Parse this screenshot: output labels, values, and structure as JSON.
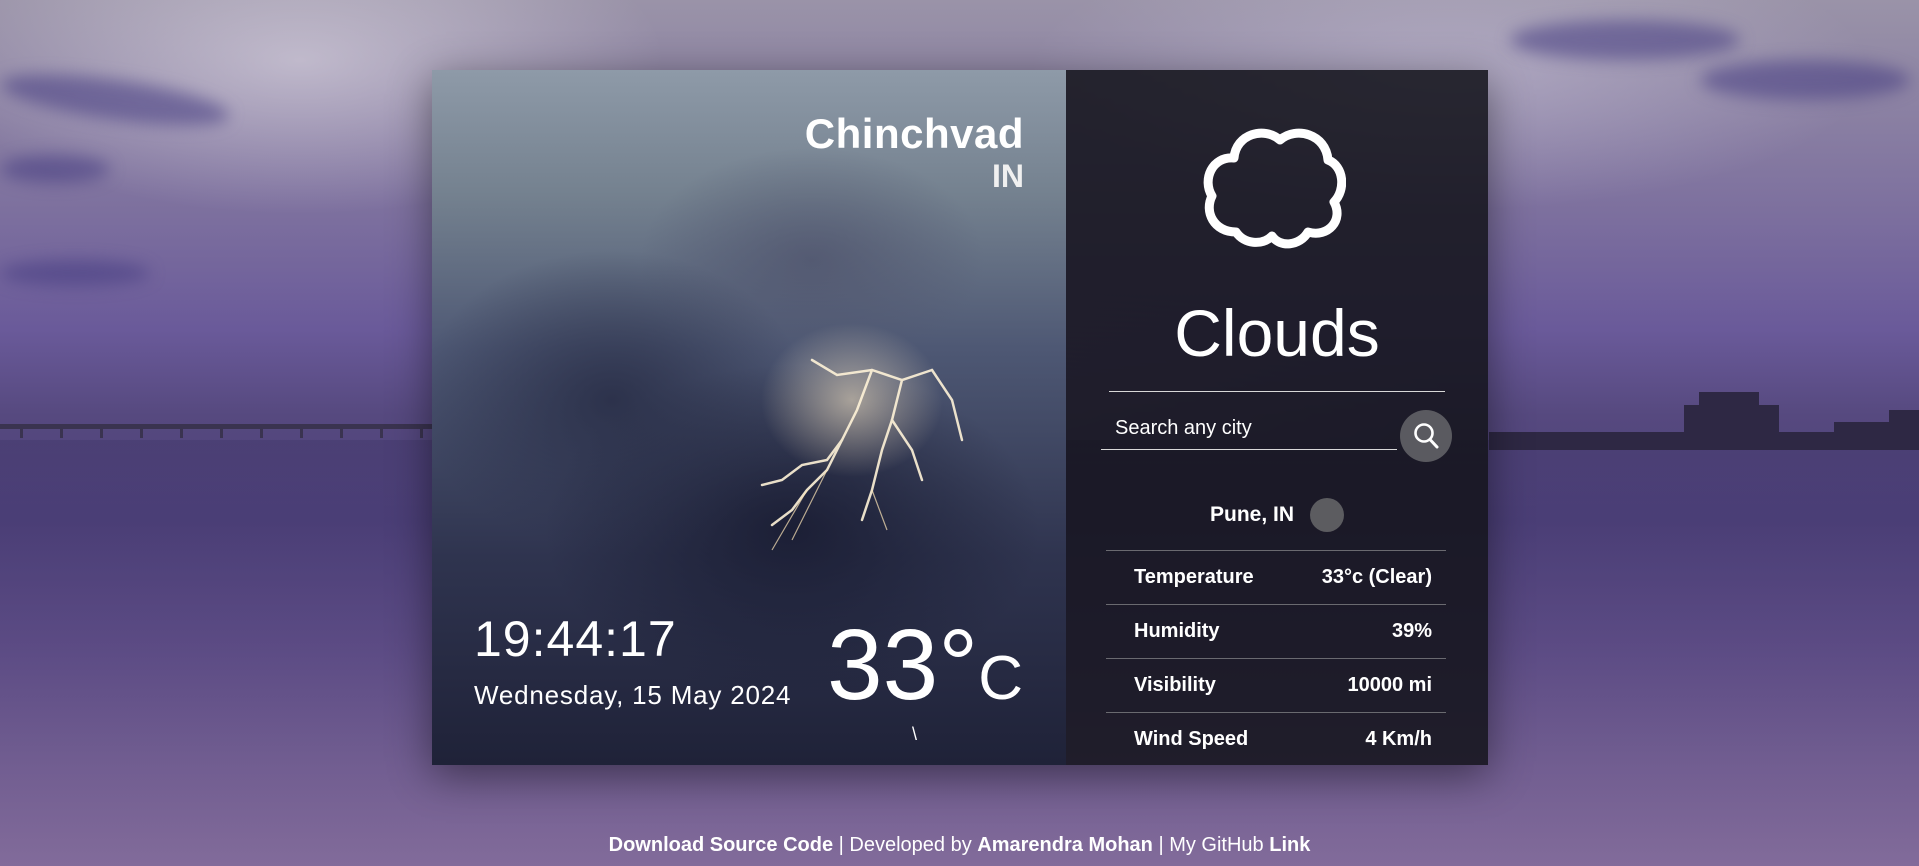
{
  "location": {
    "city": "Chinchvad",
    "country": "IN"
  },
  "clock": {
    "time": "19:44:17",
    "date": "Wednesday, 15 May 2024"
  },
  "current_temp": {
    "value": "33°",
    "unit": "C",
    "stray_char": "\\"
  },
  "weather_panel": {
    "icon": "cloud-icon",
    "condition": "Clouds",
    "search": {
      "placeholder": "Search any city",
      "button_icon": "search-icon"
    },
    "result_location": "Pune, IN",
    "details": [
      {
        "label": "Temperature",
        "value": "33°c (Clear)"
      },
      {
        "label": "Humidity",
        "value": "39%"
      },
      {
        "label": "Visibility",
        "value": "10000 mi"
      },
      {
        "label": "Wind Speed",
        "value": "4 Km/h"
      }
    ]
  },
  "footer": {
    "download_link": "Download Source Code",
    "separator1": " | ",
    "developed_by_prefix": "Developed by ",
    "developer_name": "Amarendra Mohan",
    "separator2": " | ",
    "github_prefix": "My GitHub ",
    "github_link": "Link"
  },
  "colors": {
    "panel_dark": "#14141c",
    "search_button": "#5a5a60",
    "text": "#ffffff"
  }
}
